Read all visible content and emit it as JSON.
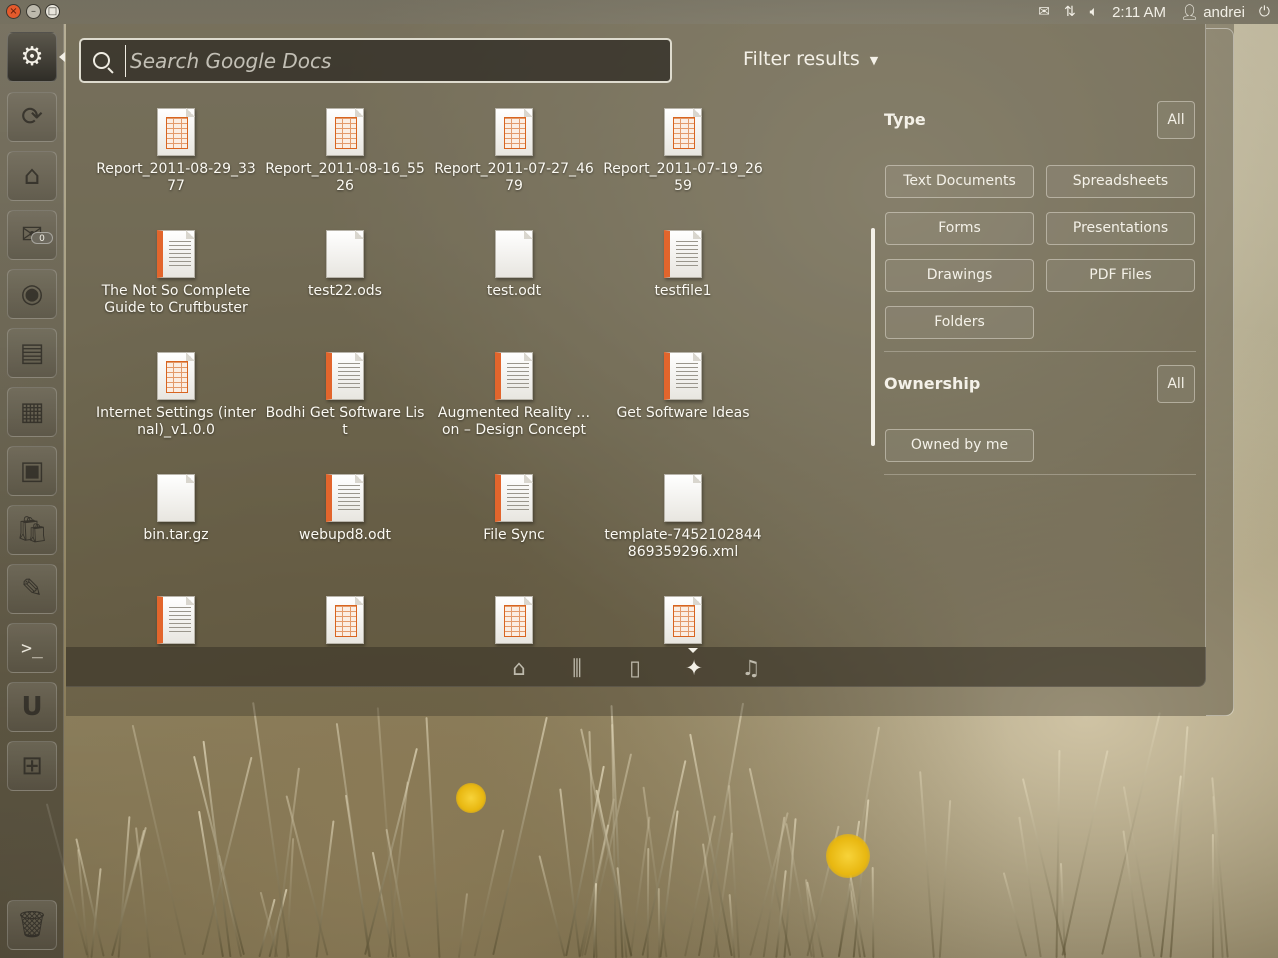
{
  "panel": {
    "time": "2:11 AM",
    "user": "andrei"
  },
  "search": {
    "placeholder": "Search Google Docs"
  },
  "filter": {
    "toggle_label": "Filter results",
    "type_title": "Type",
    "type_all": "All",
    "type_buttons": [
      "Text Documents",
      "Spreadsheets",
      "Forms",
      "Presentations",
      "Drawings",
      "PDF Files",
      "Folders"
    ],
    "ownership_title": "Ownership",
    "ownership_all": "All",
    "ownership_buttons": [
      "Owned by me"
    ]
  },
  "launcher": {
    "mail_badge": "0"
  },
  "results": [
    {
      "label": "Report_2011-08-29_3377",
      "icon": "spreadsheet"
    },
    {
      "label": "Report_2011-08-16_5526",
      "icon": "spreadsheet"
    },
    {
      "label": "Report_2011-07-27_4679",
      "icon": "spreadsheet"
    },
    {
      "label": "Report_2011-07-19_2659",
      "icon": "spreadsheet"
    },
    {
      "label": "The Not So Complete Guide to Cruftbuster",
      "icon": "text"
    },
    {
      "label": "test22.ods",
      "icon": "blank"
    },
    {
      "label": "test.odt",
      "icon": "blank"
    },
    {
      "label": "testfile1",
      "icon": "text"
    },
    {
      "label": "Internet Settings (internal)_v1.0.0",
      "icon": "spreadsheet"
    },
    {
      "label": "Bodhi Get Software List",
      "icon": "text"
    },
    {
      "label": "Augmented Reality …on – Design Concept",
      "icon": "text"
    },
    {
      "label": "Get Software Ideas",
      "icon": "text"
    },
    {
      "label": "bin.tar.gz",
      "icon": "blank"
    },
    {
      "label": "webupd8.odt",
      "icon": "text"
    },
    {
      "label": "File Sync",
      "icon": "text"
    },
    {
      "label": "template-7452102844869359296.xml",
      "icon": "blank"
    },
    {
      "label": "",
      "icon": "text"
    },
    {
      "label": "",
      "icon": "spreadsheet"
    },
    {
      "label": "",
      "icon": "spreadsheet"
    },
    {
      "label": "",
      "icon": "spreadsheet"
    }
  ],
  "lenses": [
    "home-icon",
    "applications-icon",
    "files-icon",
    "google-docs-icon",
    "music-icon"
  ],
  "colors": {
    "text": "#f4f1e8",
    "accent": "#e2652c"
  }
}
